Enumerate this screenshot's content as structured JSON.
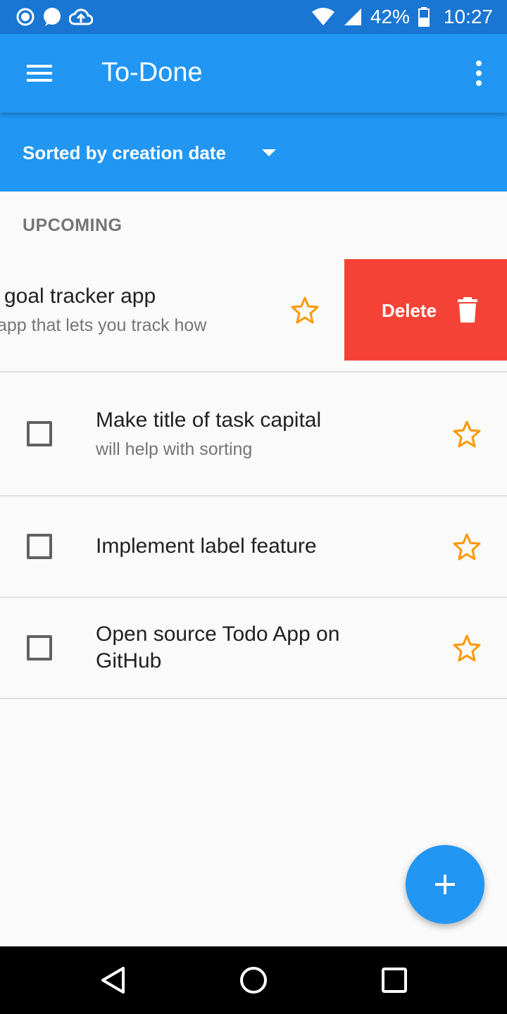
{
  "status_bar": {
    "battery": "42%",
    "time": "10:27",
    "icons": [
      "notification-circle-icon",
      "chat-bubble-icon",
      "cloud-upload-icon",
      "wifi-icon",
      "cell-signal-icon",
      "battery-icon"
    ]
  },
  "app_bar": {
    "title": "To-Done",
    "icons": [
      "menu-icon",
      "more-vert-icon"
    ]
  },
  "sort_bar": {
    "label": "Sorted by creation date"
  },
  "section": {
    "title": "UPCOMING"
  },
  "swiped_task": {
    "title": "goal tracker app",
    "subtitle": "app that lets you track how",
    "starred": false,
    "delete_label": "Delete"
  },
  "tasks": [
    {
      "title": "Make title of task capital",
      "subtitle": "will help with sorting",
      "checked": false,
      "starred": false
    },
    {
      "title": "Implement label feature",
      "subtitle": "",
      "checked": false,
      "starred": false
    },
    {
      "title": "Open source Todo App on GitHub",
      "subtitle": "",
      "checked": false,
      "starred": false
    }
  ],
  "colors": {
    "primary": "#2196f3",
    "primary_dark": "#1976d2",
    "delete": "#f44336",
    "star": "#ff9800"
  }
}
